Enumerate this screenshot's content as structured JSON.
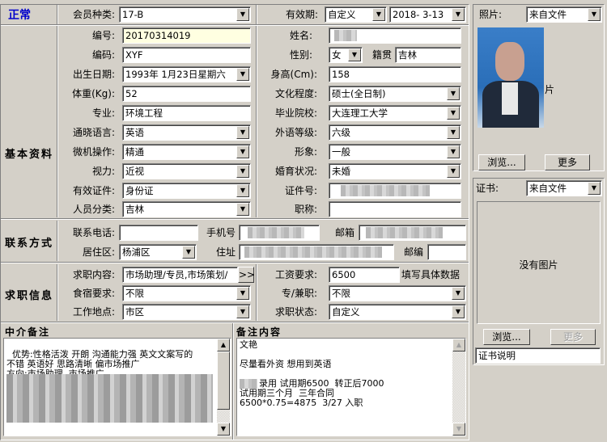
{
  "status": "正常",
  "colors": {
    "status_text": "#0000cc",
    "field_highlight": "#ffffe1"
  },
  "sections": {
    "basic": "基本资料",
    "contact": "联系方式",
    "job": "求职信息",
    "agent_note": "中介备注",
    "note_content": "备注内容"
  },
  "basic": {
    "member_type_label": "会员种类:",
    "member_type_value": "17-B",
    "validity_label": "有效期:",
    "validity_value": "自定义",
    "validity_date": "2018- 3-13",
    "id_label": "编号:",
    "id_value": "20170314019",
    "name_label": "姓名:",
    "code_label": "编码:",
    "code_value": "XYF",
    "gender_label": "性别:",
    "gender_value": "女",
    "native_label": "籍贯",
    "native_value": "吉林",
    "birth_label": "出生日期:",
    "birth_value": "1993年 1月23日星期六",
    "height_label": "身高(Cm):",
    "height_value": "158",
    "weight_label": "体重(Kg):",
    "weight_value": "52",
    "education_label": "文化程度:",
    "education_value": "硕士(全日制)",
    "major_label": "专业:",
    "major_value": "环境工程",
    "school_label": "毕业院校:",
    "school_value": "大连理工大学",
    "language_label": "通晓语言:",
    "language_value": "英语",
    "foreign_level_label": "外语等级:",
    "foreign_level_value": "六级",
    "computer_label": "微机操作:",
    "computer_value": "精通",
    "appearance_label": "形象:",
    "appearance_value": "一般",
    "vision_label": "视力:",
    "vision_value": "近视",
    "marital_label": "婚育状况:",
    "marital_value": "未婚",
    "idtype_label": "有效证件:",
    "idtype_value": "身份证",
    "idnum_label": "证件号:",
    "category_label": "人员分类:",
    "category_value": "吉林",
    "title_label": "职称:"
  },
  "contact": {
    "phone_label": "联系电话:",
    "mobile_label": "手机号",
    "email_label": "邮箱",
    "district_label": "居住区:",
    "district_value": "杨浦区",
    "address_label": "住址",
    "postcode_label": "邮编"
  },
  "job": {
    "content_label": "求职内容:",
    "content_value": "市场助理/专员,市场策划/",
    "more_button": ">>",
    "salary_label": "工资要求:",
    "salary_value": "6500",
    "salary_hint": "填写具体数据",
    "board_label": "食宿要求:",
    "board_value": "不限",
    "parttime_label": "专/兼职:",
    "parttime_value": "不限",
    "location_label": "工作地点:",
    "location_value": "市区",
    "status_label": "求职状态:",
    "status_value": "自定义"
  },
  "agent_note": "优势:性格活泼 开朗 沟通能力强 英文文案写的\n不错 英语好 思路清晰 偏市场推广\n方向:市场助理  市场推广",
  "note_content": {
    "line1": "文艳",
    "line2": "尽量看外资 想用到英语",
    "line3": "录用 试用期6500  转正后7000",
    "line4": "试用期三个月  三年合同",
    "line5": "6500*0.75=4875  3/27 入职"
  },
  "photo": {
    "label": "照片:",
    "source_value": "来自文件",
    "overlay_text": "片",
    "browse": "浏览...",
    "more": "更多"
  },
  "cert": {
    "label": "证书:",
    "source_value": "来自文件",
    "no_image": "没有图片",
    "browse": "浏览...",
    "more": "更多",
    "description": "证书说明"
  }
}
